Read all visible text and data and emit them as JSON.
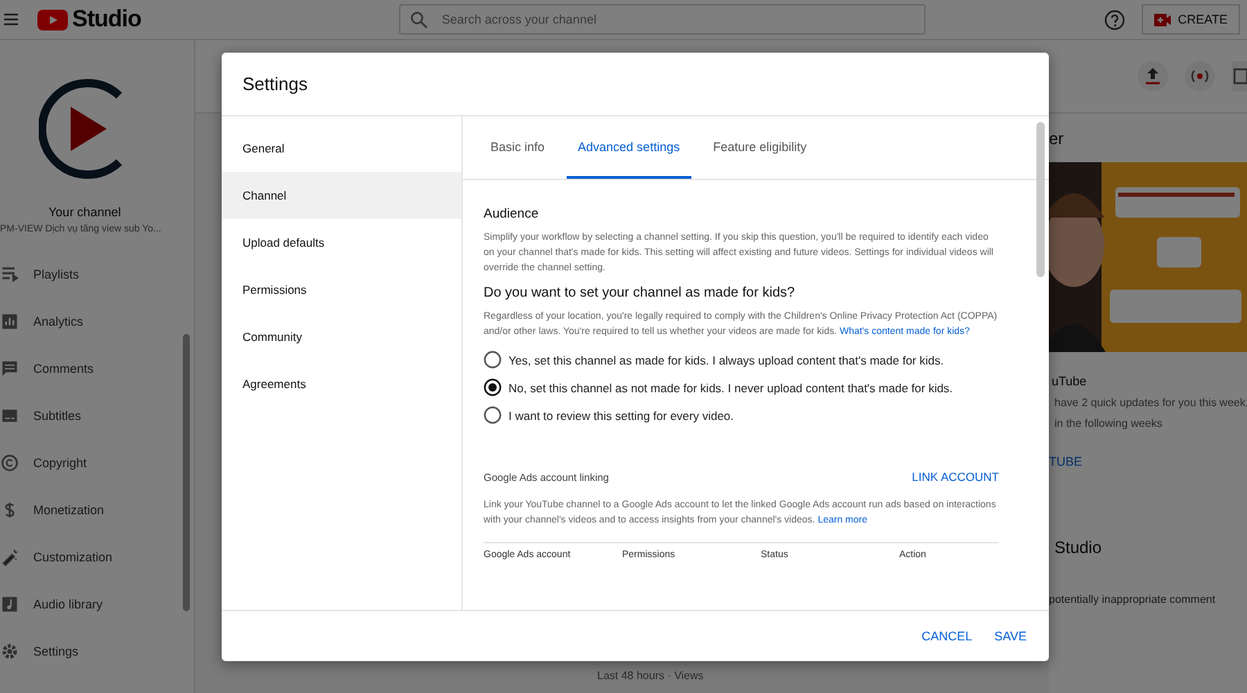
{
  "topbar": {
    "logo_text": "Studio",
    "search": {
      "placeholder": "Search across your channel"
    },
    "create_button": "CREATE"
  },
  "sidebar": {
    "channel_label": "Your channel",
    "channel_name": "PM-VIEW Dịch vụ tăng view sub Yo...",
    "items": [
      {
        "label": "Playlists"
      },
      {
        "label": "Analytics"
      },
      {
        "label": "Comments"
      },
      {
        "label": "Subtitles"
      },
      {
        "label": "Copyright"
      },
      {
        "label": "Monetization"
      },
      {
        "label": "Customization"
      },
      {
        "label": "Audio library"
      },
      {
        "label": "Settings"
      }
    ]
  },
  "main": {
    "caption": "Last 48 hours · Views"
  },
  "right_panel": {
    "title": "er",
    "news_title": "uTube",
    "news_lines": [
      "have 2 quick updates for you this week,",
      "in the following weeks"
    ],
    "news_link": "TUBE",
    "card_title": "Studio",
    "card_line": "potentially inappropriate comment"
  },
  "dialog": {
    "title": "Settings",
    "nav": [
      {
        "label": "General",
        "selected": false
      },
      {
        "label": "Channel",
        "selected": true
      },
      {
        "label": "Upload defaults",
        "selected": false
      },
      {
        "label": "Permissions",
        "selected": false
      },
      {
        "label": "Community",
        "selected": false
      },
      {
        "label": "Agreements",
        "selected": false
      }
    ],
    "tabs": [
      {
        "label": "Basic info",
        "selected": false
      },
      {
        "label": "Advanced settings",
        "selected": true
      },
      {
        "label": "Feature eligibility",
        "selected": false
      }
    ],
    "audience": {
      "heading": "Audience",
      "description": "Simplify your workflow by selecting a channel setting. If you skip this question, you'll be required to identify each video on your channel that's made for kids. This setting will affect existing and future videos. Settings for individual videos will override the channel setting.",
      "question": "Do you want to set your channel as made for kids?",
      "legal_text": "Regardless of your location, you're legally required to comply with the Children's Online Privacy Protection Act (COPPA) and/or other laws. You're required to tell us whether your videos are made for kids.",
      "legal_link": "What's content made for kids?",
      "options": [
        {
          "label": "Yes, set this channel as made for kids. I always upload content that's made for kids.",
          "selected": false
        },
        {
          "label": "No, set this channel as not made for kids. I never upload content that's made for kids.",
          "selected": true
        },
        {
          "label": "I want to review this setting for every video.",
          "selected": false
        }
      ]
    },
    "ads": {
      "heading": "Google Ads account linking",
      "link_button": "LINK ACCOUNT",
      "description": "Link your YouTube channel to a Google Ads account to let the linked Google Ads account run ads based on interactions with your channel's videos and to access insights from your channel's videos.",
      "learn_more": "Learn more",
      "columns": [
        "Google Ads account",
        "Permissions",
        "Status",
        "Action"
      ]
    },
    "buttons": [
      "CANCEL",
      "SAVE"
    ]
  }
}
